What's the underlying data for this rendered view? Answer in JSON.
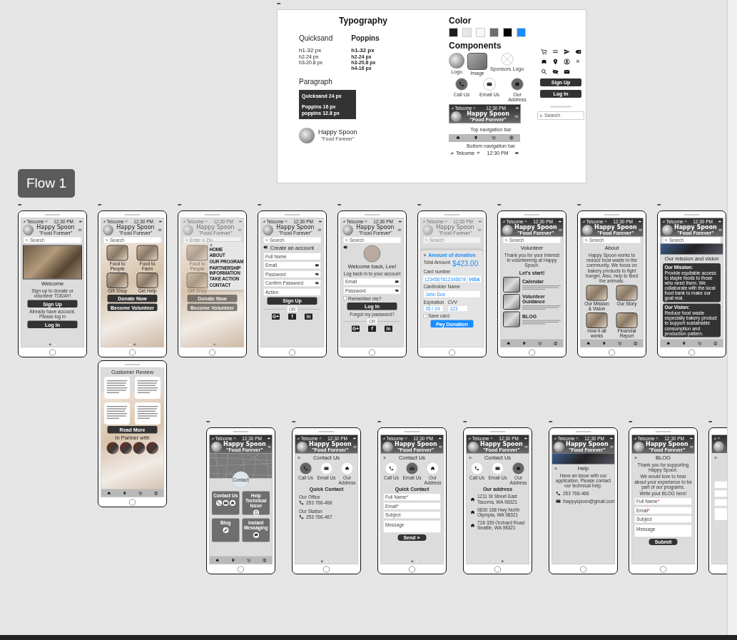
{
  "style_guide": {
    "handle": "•••",
    "typography_title": "Typography",
    "fonts": [
      {
        "name": "Quicksand",
        "sizes": [
          "h1-32 px",
          "h2-24 px",
          "h3-20.8 px"
        ]
      },
      {
        "name": "Poppins",
        "sizes": [
          "h1-32 px",
          "h2-24 px",
          "h3-20.8 px",
          "h4-16 px"
        ]
      }
    ],
    "paragraph_title": "Paragraph",
    "paragraph_lines": [
      "Quicksand 24 px",
      "Poppins 16 px",
      "poppins 12.8 px"
    ],
    "brand": {
      "title": "Happy Spoon",
      "tagline": "\"Food Forever\""
    },
    "color_title": "Color",
    "swatches": [
      {
        "color": "#1e1e1e"
      },
      {
        "color": "#e6e6e6"
      },
      {
        "color": "#f7f7f7"
      },
      {
        "color": "#6e6e6e"
      },
      {
        "color": "#000000"
      },
      {
        "color": "#1a8cff"
      }
    ],
    "components_title": "Components",
    "logo_caption": "Logo",
    "image_caption": "Image",
    "sponsor_caption": "Sponsors Logo",
    "contact_buttons": [
      {
        "kind": "phone",
        "caption": "Call Us",
        "selected": true
      },
      {
        "kind": "email",
        "caption": "Email Us",
        "selected": false
      },
      {
        "kind": "address",
        "caption": "Our Address",
        "selected": true
      }
    ],
    "close_glyph": "×",
    "buttons": [
      "Sign Up",
      "Log In"
    ],
    "search_placeholder": "Search",
    "top_nav": {
      "carrier": "Telcome",
      "time": "12:30 PM",
      "title": "Happy Spoon",
      "tagline": "\"Food Forever\"",
      "caption": "Top navigation bar"
    },
    "bottom_nav_caption": "Bottom navigation bar",
    "status_sample": {
      "carrier": "Telcome",
      "time": "12:30 PM"
    }
  },
  "flow_label": "Flow 1",
  "screens": [
    {
      "handle": "•••",
      "status": {
        "carrier": "Telcome",
        "time": "12:30 PM"
      },
      "header": {
        "dark": false,
        "title": "Happy Spoon",
        "tagline": "\"Food Forever\""
      },
      "search": {
        "placeholder": "Search"
      },
      "background_photo": false,
      "faded": false,
      "bottom_nav": false,
      "blocks": [
        {
          "kind": "photo"
        },
        {
          "kind": "heading",
          "text": "Welcome"
        },
        {
          "kind": "text",
          "text": "Sign up to donate or volunteer TODAY!"
        },
        {
          "kind": "button",
          "label": "Sign Up"
        },
        {
          "kind": "text",
          "text": "Already have account, Please log in"
        },
        {
          "kind": "button",
          "label": "Log In"
        },
        {
          "kind": "dots",
          "pages": [
            {
              "selected": true
            },
            {
              "selected": false
            }
          ]
        }
      ]
    },
    {
      "handle": "•••",
      "status": {
        "carrier": "Telcome",
        "time": "12:30 PM"
      },
      "header": {
        "dark": false,
        "title": "Happy Spoon",
        "tagline": "\"Food Forever\""
      },
      "search": {
        "placeholder": "Search"
      },
      "background_photo": true,
      "faded": false,
      "bottom_nav": false,
      "blocks": [
        {
          "kind": "tiles",
          "items": [
            {
              "kind": "tile",
              "caption": "Food to People"
            },
            {
              "kind": "tile",
              "caption": "Food to Farm"
            },
            {
              "kind": "tile",
              "caption": "Gift Shop"
            },
            {
              "kind": "tile",
              "caption": "Get Help"
            }
          ]
        },
        {
          "kind": "button",
          "label": "Donate Now"
        },
        {
          "kind": "button",
          "label": "Become Volunteer"
        },
        {
          "kind": "dots",
          "pages": [
            {
              "selected": false
            },
            {
              "selected": true
            }
          ]
        }
      ]
    },
    {
      "background_photo": true,
      "faded": false,
      "bottom_nav": true,
      "blocks": [
        {
          "kind": "heading",
          "text": "Customer Review"
        },
        {
          "kind": "reviews",
          "cards": [
            {
              "kind": "review"
            },
            {
              "kind": "review"
            },
            {
              "kind": "review"
            },
            {
              "kind": "review"
            }
          ]
        },
        {
          "kind": "button",
          "label": "Read More"
        },
        {
          "kind": "heading",
          "text": "In Partner with"
        },
        {
          "kind": "partners",
          "logos": [
            {
              "kind": "logo"
            },
            {
              "kind": "logo"
            },
            {
              "kind": "logo"
            },
            {
              "kind": "logo"
            }
          ]
        }
      ]
    },
    {
      "handle": "•••",
      "status": {
        "carrier": "Telcome",
        "time": "12:30 PM"
      },
      "header": {
        "dark": false,
        "title": "Happy Spoon",
        "tagline": "\"Food Forever\""
      },
      "search": {
        "placeholder": "Enter a Zip"
      },
      "background_photo": true,
      "faded": true,
      "bottom_nav": false,
      "menu": {
        "close": "×",
        "items": [
          "HOME",
          "ABOUT",
          "OUR PROGRAM",
          "PARTNERSHIP INFORMATION",
          "TAKE ACTION",
          "CONTACT"
        ]
      },
      "blocks": [
        {
          "kind": "tiles",
          "items": [
            {
              "kind": "tile",
              "caption": "Food to People"
            },
            {
              "kind": "tile"
            },
            {
              "kind": "tile",
              "caption": "Gift Shop"
            },
            {
              "kind": "tile"
            }
          ]
        },
        {
          "kind": "button",
          "label": "Donate Now"
        },
        {
          "kind": "button",
          "label": "Become Volunteer"
        },
        {
          "kind": "dots",
          "pages": [
            {
              "selected": false
            },
            {
              "selected": true
            }
          ]
        }
      ]
    },
    {
      "handle": "•••",
      "status": {
        "carrier": "Telcome",
        "time": "12:30 PM"
      },
      "header": {
        "dark": false,
        "title": "Happy Spoon",
        "tagline": "\"Food Forever\""
      },
      "search": {
        "placeholder": "Search"
      },
      "background_photo": false,
      "faded": false,
      "bottom_nav": false,
      "blocks": [
        {
          "kind": "heading",
          "text": "Create an account",
          "back": true
        },
        {
          "kind": "field",
          "placeholder": "Full Name"
        },
        {
          "kind": "mail_field",
          "placeholder": "Email"
        },
        {
          "kind": "password_field",
          "placeholder": "Password"
        },
        {
          "kind": "password_field",
          "placeholder": "Confirm Password"
        },
        {
          "kind": "field",
          "placeholder": "Action"
        },
        {
          "kind": "button",
          "label": "Sign Up"
        },
        {
          "kind": "or",
          "text": "OR"
        },
        {
          "kind": "social",
          "items": [
            "G+",
            "f",
            "in"
          ]
        }
      ]
    },
    {
      "handle": "•••",
      "status": {
        "carrier": "Telcome",
        "time": "12:30 PM"
      },
      "header": {
        "dark": false,
        "title": "Happy Spoon",
        "tagline": "\"Food Forever\""
      },
      "search": {
        "placeholder": "Search"
      },
      "background_photo": false,
      "faded": false,
      "bottom_nav": false,
      "blocks": [
        {
          "kind": "avatar",
          "back": true
        },
        {
          "kind": "heading",
          "text": "Welcome back, Lee!"
        },
        {
          "kind": "text",
          "text": "Log back in to your account"
        },
        {
          "kind": "mail_field",
          "placeholder": "Email"
        },
        {
          "kind": "password_field",
          "placeholder": "Password"
        },
        {
          "kind": "checkbox",
          "label": "Remember me?",
          "checked": false
        },
        {
          "kind": "button",
          "label": "Log In"
        },
        {
          "kind": "link",
          "text": "Forgot my password?"
        },
        {
          "kind": "or",
          "text": "OR"
        },
        {
          "kind": "social",
          "items": [
            "G+",
            "f",
            "in"
          ]
        }
      ]
    },
    {
      "handle": "•••",
      "status": {
        "carrier": "Telcome",
        "time": "12:30 PM"
      },
      "header": {
        "dark": false,
        "title": "Happy Spoon",
        "tagline": "\"Food Forever\""
      },
      "search": {
        "placeholder": "Search"
      },
      "background_photo": false,
      "faded": true,
      "bottom_nav": false,
      "blocks": [
        {
          "kind": "sheet",
          "blocks": [
            {
              "kind": "accent_heading",
              "text": "Amount of donation",
              "close": "×"
            },
            {
              "kind": "amount",
              "label": "Total Amount",
              "value": "$423.00"
            },
            {
              "kind": "label",
              "text": "Card number"
            },
            {
              "kind": "card_number",
              "groups": [
                "1234",
                "5678",
                "1234",
                "5678"
              ],
              "brand": "VISA"
            },
            {
              "kind": "label",
              "text": "Cardholder Name"
            },
            {
              "kind": "field",
              "value": "John Doe"
            },
            {
              "kind": "pair",
              "items": [
                {
                  "label": "Expiration",
                  "value": "05 / 24"
                },
                {
                  "label": "CVV",
                  "value": "123"
                }
              ]
            },
            {
              "kind": "checkbox",
              "label": "Save card",
              "checked": false
            },
            {
              "kind": "accent_button",
              "label": "Pay Donation"
            }
          ]
        }
      ]
    },
    {
      "handle": "•••",
      "status": {
        "carrier": "Telcome",
        "time": "12:30 PM"
      },
      "header": {
        "dark": true,
        "title": "Happy Spoon",
        "tagline": "\"Food Forever\""
      },
      "search": {
        "placeholder": "Search"
      },
      "background_photo": false,
      "faded": false,
      "bottom_nav": true,
      "blocks": [
        {
          "kind": "heading",
          "text": "Volunteer"
        },
        {
          "kind": "text",
          "text": "Thank you for your interest in volunteering at Happy Spoon."
        },
        {
          "kind": "subheading",
          "text": "Let's start!"
        },
        {
          "kind": "feature",
          "title": "Calendar"
        },
        {
          "kind": "feature",
          "title": "Volunteer Guidance"
        },
        {
          "kind": "feature",
          "title": "BLOG"
        }
      ]
    },
    {
      "handle": "•••",
      "status": {
        "carrier": "Telcome",
        "time": "12:30 PM"
      },
      "header": {
        "dark": true,
        "title": "Happy Spoon",
        "tagline": "\"Food Forever\""
      },
      "search": {
        "placeholder": "Search"
      },
      "background_photo": false,
      "faded": false,
      "bottom_nav": true,
      "blocks": [
        {
          "kind": "heading",
          "text": "About"
        },
        {
          "kind": "text",
          "text": "Happy Spoon works to reduce food waste in the community. We focus on bakery products to fight hunger. Also, help to feed the animals."
        },
        {
          "kind": "tiles",
          "items": [
            {
              "kind": "tile",
              "caption": "Our Mission & Vision"
            },
            {
              "kind": "tile",
              "caption": "Our Story"
            },
            {
              "kind": "tile",
              "caption": "How it all works"
            },
            {
              "kind": "tile",
              "caption": "Financial Report"
            }
          ]
        }
      ]
    },
    {
      "handle": "•••",
      "status": {
        "carrier": "Telcome",
        "time": "12:30 PM"
      },
      "header": {
        "dark": true,
        "title": "Happy Spoon",
        "tagline": "\"Food Forever\""
      },
      "search": {
        "placeholder": "Search"
      },
      "background_photo": false,
      "faded": false,
      "bottom_nav": true,
      "blocks": [
        {
          "kind": "banner"
        },
        {
          "kind": "heading",
          "text": "Our mission and vision"
        },
        {
          "kind": "card",
          "heading": "Our Mission:",
          "text": "Provide equitable access to staple foods to those who need them. We collaborate with the local food bank to make our goal real."
        },
        {
          "kind": "card",
          "heading": "Our Vision:",
          "text": "Reduce food waste especially bakery product to support sustainable consumption and production pattern."
        }
      ]
    },
    {
      "handle": "•••",
      "status": {
        "carrier": "Telcome",
        "time": "12:30 PM"
      },
      "header": {
        "dark": true,
        "title": "Happy Spoon",
        "tagline": "\"Food Forever\""
      },
      "background_photo": false,
      "faded": false,
      "bottom_nav": true,
      "blocks": [
        {
          "kind": "map",
          "label": "Contact"
        },
        {
          "kind": "action_tiles",
          "items": [
            {
              "kind": "contact",
              "title": "Contact Us"
            },
            {
              "kind": "help",
              "title": "Help Technical Issue"
            },
            {
              "kind": "blog",
              "title": "Blog"
            },
            {
              "kind": "chat",
              "title": "Instant Messaging"
            }
          ]
        }
      ]
    },
    {
      "handle": "•••",
      "status": {
        "carrier": "Telcome",
        "time": "12:30 PM"
      },
      "header": {
        "dark": true,
        "title": "Happy Spoon",
        "tagline": "\"Food Forever\""
      },
      "background_photo": false,
      "faded": false,
      "bottom_nav": false,
      "blocks": [
        {
          "kind": "heading",
          "text": "Contact Us",
          "close": "×"
        },
        {
          "kind": "circles",
          "items": [
            {
              "kind": "phone",
              "caption": "Call Us",
              "selected": true
            },
            {
              "kind": "email",
              "caption": "Email Us",
              "selected": false
            },
            {
              "kind": "address",
              "caption": "Our Address",
              "selected": false
            }
          ]
        },
        {
          "kind": "subheading",
          "text": "Quick Contact"
        },
        {
          "kind": "phone_entry",
          "label": "Our Office",
          "lines": [
            "253 766-466"
          ]
        },
        {
          "kind": "phone_entry",
          "label": "Our Station",
          "lines": [
            "253 766-467"
          ]
        },
        {
          "kind": "dots",
          "pages": [
            {
              "selected": true
            },
            {
              "selected": false
            },
            {
              "selected": false
            }
          ]
        }
      ]
    },
    {
      "handle": "•••",
      "status": {
        "carrier": "Telcome",
        "time": "12:30 PM"
      },
      "header": {
        "dark": true,
        "title": "Happy Spoon",
        "tagline": "\"Food Forever\""
      },
      "background_photo": false,
      "faded": false,
      "bottom_nav": false,
      "blocks": [
        {
          "kind": "heading",
          "text": "Contact Us",
          "close": "×"
        },
        {
          "kind": "circles",
          "items": [
            {
              "kind": "phone",
              "caption": "Call Us",
              "selected": false
            },
            {
              "kind": "email",
              "caption": "Email Us",
              "selected": true
            },
            {
              "kind": "address",
              "caption": "Our Address",
              "selected": false
            }
          ]
        },
        {
          "kind": "subheading",
          "text": "Quick Contact"
        },
        {
          "kind": "field",
          "placeholder": "Full Name",
          "mark": "*"
        },
        {
          "kind": "field",
          "placeholder": "Email",
          "mark": "*"
        },
        {
          "kind": "field",
          "placeholder": "Subject"
        },
        {
          "kind": "textarea",
          "placeholder": "Message"
        },
        {
          "kind": "send_button",
          "label": "Send"
        },
        {
          "kind": "dots",
          "pages": [
            {
              "selected": false
            },
            {
              "selected": true
            },
            {
              "selected": false
            }
          ]
        }
      ]
    },
    {
      "handle": "•••",
      "status": {
        "carrier": "Telcome",
        "time": "12:30 PM"
      },
      "header": {
        "dark": true,
        "title": "Happy Spoon",
        "tagline": "\"Food Forever\""
      },
      "background_photo": false,
      "faded": false,
      "bottom_nav": false,
      "blocks": [
        {
          "kind": "heading",
          "text": "Contact Us",
          "close": "×"
        },
        {
          "kind": "circles",
          "items": [
            {
              "kind": "phone",
              "caption": "Call Us",
              "selected": false
            },
            {
              "kind": "email",
              "caption": "Email Us",
              "selected": false
            },
            {
              "kind": "address",
              "caption": "Our Address",
              "selected": true
            }
          ]
        },
        {
          "kind": "subheading",
          "text": "Our address"
        },
        {
          "kind": "address_entry",
          "lines": [
            "1211 St Street East",
            "Tacoma, WA 98321"
          ]
        },
        {
          "kind": "address_entry",
          "lines": [
            "9830 168 Hwy North",
            "Olympia, WA 98321"
          ]
        },
        {
          "kind": "address_entry",
          "lines": [
            "718 339 Orchard Road",
            "Seattle, WA 98321"
          ]
        },
        {
          "kind": "dots",
          "pages": [
            {
              "selected": false
            },
            {
              "selected": false
            },
            {
              "selected": true
            }
          ]
        }
      ]
    },
    {
      "handle": "•••",
      "status": {
        "carrier": "Telcome",
        "time": "12:30 PM"
      },
      "header": {
        "dark": true,
        "title": "Happy Spoon",
        "tagline": "\"Food Forever\""
      },
      "background_photo": false,
      "faded": false,
      "bottom_nav": false,
      "blocks": [
        {
          "kind": "banner"
        },
        {
          "kind": "heading",
          "text": "Help",
          "close": "×"
        },
        {
          "kind": "text",
          "text": "Have an issue with our application. Please contact our technical help."
        },
        {
          "kind": "phone_entry",
          "lines": [
            "253 766-466"
          ]
        },
        {
          "kind": "email_entry",
          "lines": [
            "ihappyspoon@gmail.com"
          ]
        }
      ]
    },
    {
      "handle": "•••",
      "status": {
        "carrier": "Telcome",
        "time": "12:30 PM"
      },
      "header": {
        "dark": true,
        "title": "Happy Spoon",
        "tagline": "\"Food Forever\""
      },
      "background_photo": false,
      "faded": false,
      "bottom_nav": false,
      "blocks": [
        {
          "kind": "heading",
          "text": "BLOG",
          "close": "×"
        },
        {
          "kind": "text",
          "text": "Thank you for supporting Happy Spoon."
        },
        {
          "kind": "text",
          "text": "We would love to hear about your experience to be part of our programs."
        },
        {
          "kind": "text",
          "text": "Write your BLOG here!"
        },
        {
          "kind": "field",
          "placeholder": "Full Name",
          "mark": "*"
        },
        {
          "kind": "field",
          "placeholder": "Email",
          "mark": "*"
        },
        {
          "kind": "field",
          "placeholder": "Subject"
        },
        {
          "kind": "textarea",
          "placeholder": "Message"
        },
        {
          "kind": "button_small",
          "label": "Submit"
        }
      ]
    },
    {
      "handle": "•••",
      "header": {
        "dark": true
      },
      "background_photo": false,
      "faded": false,
      "bottom_nav": false,
      "blocks": [
        {
          "kind": "heading",
          "close": "×"
        },
        {
          "kind": "spacer"
        },
        {
          "kind": "field"
        },
        {
          "kind": "field"
        },
        {
          "kind": "field"
        },
        {
          "kind": "textarea"
        }
      ]
    }
  ]
}
